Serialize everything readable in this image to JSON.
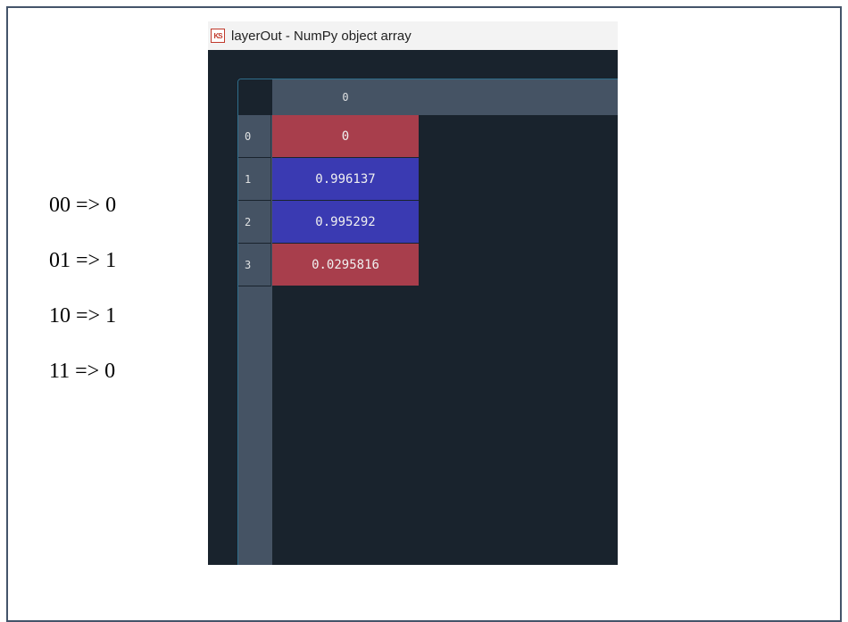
{
  "mapping_lines": [
    "00 => 0",
    "01 => 1",
    "10 => 1",
    "11 => 0"
  ],
  "window": {
    "title": "layerOut - NumPy object array",
    "icon_text": "KS",
    "column_header": "0",
    "rows": [
      {
        "index": "0",
        "value": "0",
        "color": "#a83e4c"
      },
      {
        "index": "1",
        "value": "0.996137",
        "color": "#3a3ab2"
      },
      {
        "index": "2",
        "value": "0.995292",
        "color": "#3a3ab2"
      },
      {
        "index": "3",
        "value": "0.0295816",
        "color": "#a83e4c"
      }
    ]
  },
  "colors": {
    "background": "#19232d",
    "header": "#455364",
    "accent_border": "#2f6e8c"
  }
}
